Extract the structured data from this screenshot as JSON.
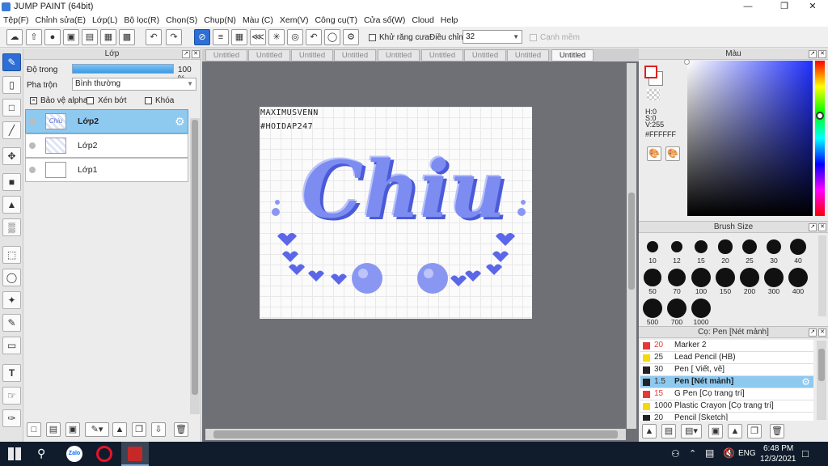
{
  "window": {
    "title": "JUMP PAINT (64bit)"
  },
  "menu": [
    "Tệp(F)",
    "Chỉnh sửa(E)",
    "Lớp(L)",
    "Bộ lọc(R)",
    "Chọn(S)",
    "Chụp(N)",
    "Màu (C)",
    "Xem(V)",
    "Công cụ(T)",
    "Cửa số(W)",
    "Cloud",
    "Help"
  ],
  "toolbar": {
    "antialias_label": "Khử răng cưa",
    "adjust_label": "Điều chỉnh",
    "adjust_value": "32",
    "smooth_label": "Cạnh mềm"
  },
  "layer_panel": {
    "title": "Lớp",
    "opacity_label": "Độ trong",
    "opacity_value": "100 %",
    "opacity_fraction": 1.0,
    "blend_label": "Pha trộn",
    "blend_value": "Bình thường",
    "protect_alpha": "Bảo vệ alpha",
    "clip": "Xén bớt",
    "lock": "Khóa",
    "layers": [
      {
        "name": "Lớp2",
        "thumb": "Chiu",
        "selected": true
      },
      {
        "name": "Lớp2",
        "selected": false
      },
      {
        "name": "Lớp1",
        "selected": false
      }
    ]
  },
  "tabs": [
    "Untitled",
    "Untitled",
    "Untitled",
    "Untitled",
    "Untitled",
    "Untitled",
    "Untitled",
    "Untitled",
    "Untitled"
  ],
  "artwork": {
    "line1": "MAXIMUSVENN",
    "line2": "#HOIDAP247",
    "word": "Chiu"
  },
  "color_panel": {
    "title": "Màu",
    "h": "H:0",
    "s": "S:0",
    "v": "V:255",
    "hex": "#FFFFFF"
  },
  "brush_size_panel": {
    "title": "Brush Size",
    "sizes": [
      "10",
      "12",
      "15",
      "20",
      "25",
      "30",
      "40",
      "50",
      "70",
      "100",
      "150",
      "200",
      "300",
      "400",
      "500",
      "700",
      "1000"
    ]
  },
  "brush_panel": {
    "title": "Cọ: Pen [Nét mảnh]",
    "items": [
      {
        "size": "20",
        "name": "Marker 2",
        "color": "#e53935"
      },
      {
        "size": "25",
        "name": "Lead Pencil (HB)",
        "color": "#f5d90a"
      },
      {
        "size": "30",
        "name": "Pen [ Viết, vẽ]",
        "color": "#222222"
      },
      {
        "size": "1.5",
        "name": "Pen [Nét mảnh]",
        "color": "#222222",
        "selected": true
      },
      {
        "size": "15",
        "name": "G Pen [Cọ trang trí]",
        "color": "#e53935"
      },
      {
        "size": "1000",
        "name": "Plastic Crayon [Cọ trang trí]",
        "color": "#f5d90a"
      },
      {
        "size": "20",
        "name": "Pencil [Sketch]",
        "color": "#222222"
      }
    ]
  },
  "taskbar": {
    "zalo": "Zalo",
    "lang": "ENG",
    "time": "6:48 PM",
    "date": "12/3/2021"
  },
  "colors": {
    "accent": "#2d6fd6",
    "selected_row": "#8ec9f0",
    "canvas_bg": "#6e7075",
    "art_blue": "#7c8cf0"
  }
}
